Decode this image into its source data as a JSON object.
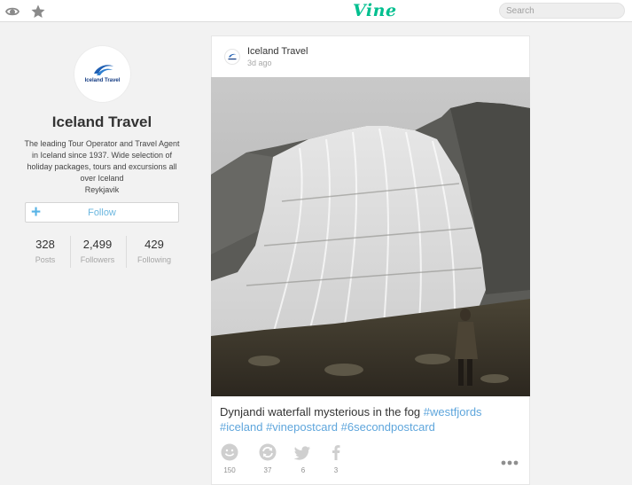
{
  "header": {
    "logo_text": "Vine",
    "search_placeholder": "Search",
    "left_icons": [
      "eye-icon",
      "star-icon"
    ],
    "brand_color": "#00bf8f"
  },
  "profile": {
    "avatar_text": "Iceland Travel",
    "name": "Iceland Travel",
    "bio": "The leading Tour Operator and Travel Agent in Iceland since 1937. Wide selection of holiday packages, tours and excursions all over Iceland",
    "location": "Reykjavik",
    "follow_label": "Follow",
    "stats": [
      {
        "value": "328",
        "label": "Posts"
      },
      {
        "value": "2,499",
        "label": "Followers"
      },
      {
        "value": "429",
        "label": "Following"
      }
    ]
  },
  "post": {
    "author": "Iceland Travel",
    "time": "3d ago",
    "caption_text": "Dynjandi waterfall mysterious in the fog",
    "hashtags": [
      "#westfjords",
      "#iceland",
      "#vinepostcard",
      "#6secondpostcard"
    ],
    "actions": [
      {
        "icon": "smiley-icon",
        "count": "150"
      },
      {
        "icon": "revine-icon",
        "count": "37"
      },
      {
        "icon": "twitter-icon",
        "count": "6"
      },
      {
        "icon": "facebook-icon",
        "count": "3"
      }
    ],
    "more_icon": "more-icon",
    "accent_color": "#5fa6dc"
  }
}
